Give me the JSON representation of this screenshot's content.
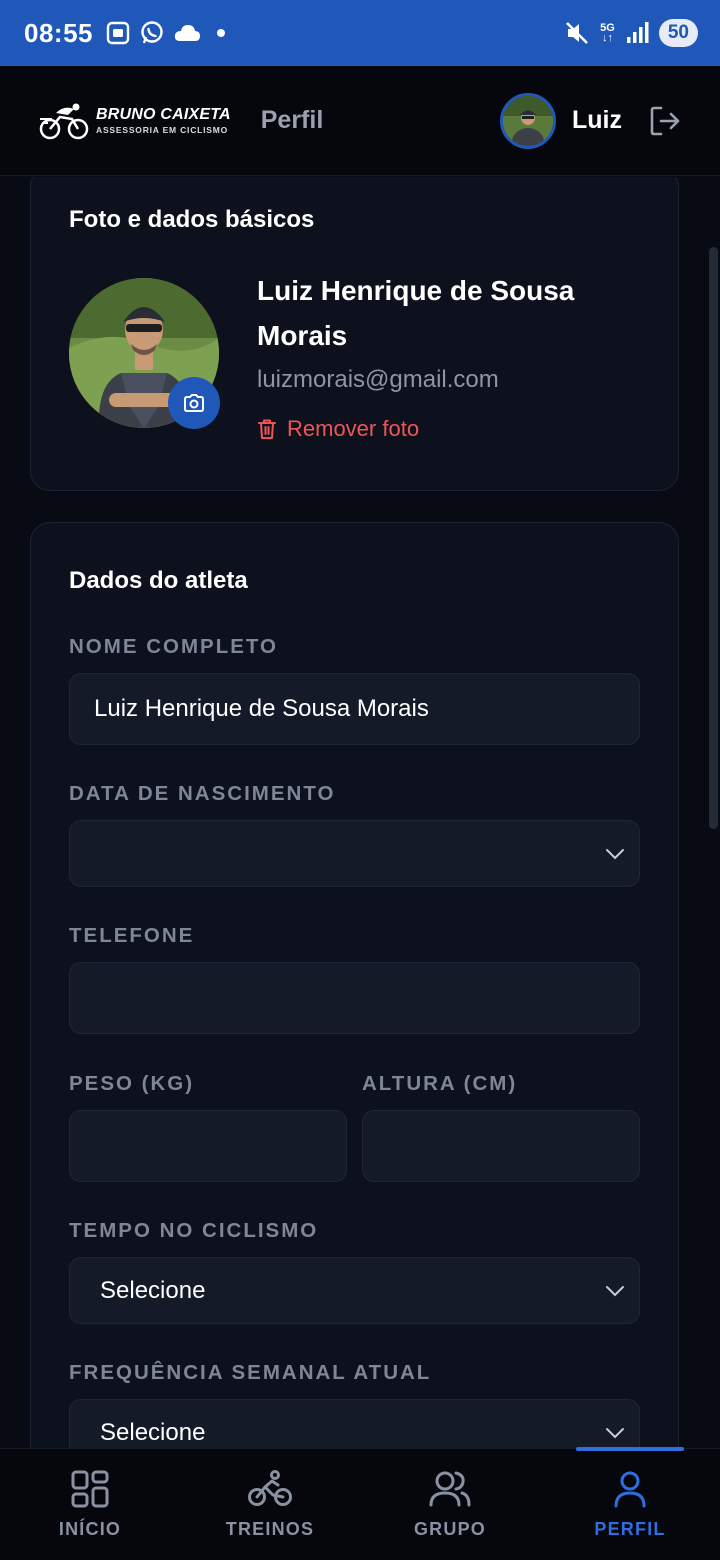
{
  "status_bar": {
    "time": "08:55",
    "battery": "50",
    "network": "5G"
  },
  "header": {
    "brand_name": "BRUNO CAIXETA",
    "brand_sub": "ASSESSORIA EM CICLISMO",
    "page_title": "Perfil",
    "user_name": "Luiz"
  },
  "basic_card": {
    "title": "Foto e dados básicos",
    "full_name": "Luiz Henrique de Sousa Morais",
    "email": "luizmorais@gmail.com",
    "remove_photo": "Remover foto"
  },
  "athlete_card": {
    "title": "Dados do atleta",
    "fields": {
      "full_name": {
        "label": "NOME COMPLETO",
        "value": "Luiz Henrique de Sousa Morais"
      },
      "birth_date": {
        "label": "DATA DE NASCIMENTO",
        "value": ""
      },
      "phone": {
        "label": "TELEFONE",
        "value": ""
      },
      "weight": {
        "label": "PESO (KG)",
        "value": ""
      },
      "height": {
        "label": "ALTURA (CM)",
        "value": ""
      },
      "cycling_time": {
        "label": "TEMPO NO CICLISMO",
        "value": "Selecione"
      },
      "weekly_frequency": {
        "label": "FREQUÊNCIA SEMANAL ATUAL",
        "value": "Selecione"
      }
    }
  },
  "bottom_nav": {
    "items": [
      {
        "label": "INÍCIO",
        "icon": "grid-icon"
      },
      {
        "label": "TREINOS",
        "icon": "bike-icon"
      },
      {
        "label": "GRUPO",
        "icon": "users-icon"
      },
      {
        "label": "PERFIL",
        "icon": "user-icon",
        "active": true
      }
    ]
  },
  "colors": {
    "accent": "#1f58b8",
    "active_nav": "#2f6ee0",
    "danger": "#f05555",
    "background": "#080b14",
    "card": "#0c111d"
  }
}
